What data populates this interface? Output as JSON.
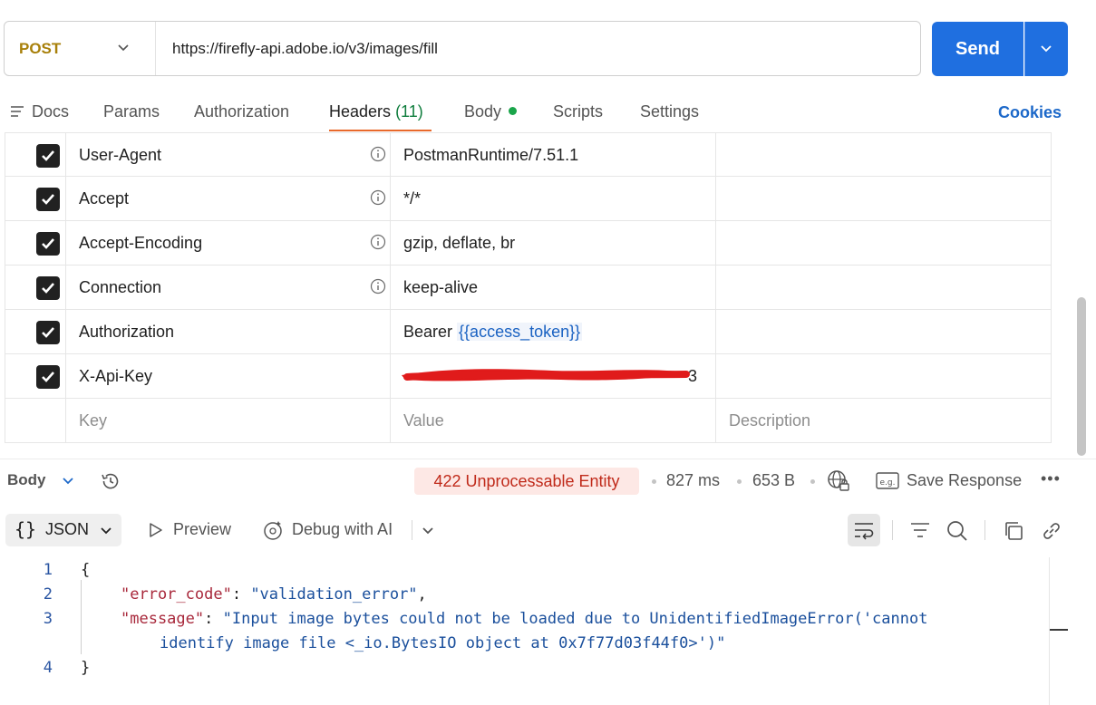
{
  "request": {
    "method": "POST",
    "url": "https://firefly-api.adobe.io/v3/images/fill",
    "send_label": "Send"
  },
  "tabs": [
    {
      "label": "Docs"
    },
    {
      "label": "Params"
    },
    {
      "label": "Authorization"
    },
    {
      "label": "Headers",
      "count": "(11)",
      "active": true
    },
    {
      "label": "Body",
      "has_dot": true
    },
    {
      "label": "Scripts"
    },
    {
      "label": "Settings"
    }
  ],
  "cookies_label": "Cookies",
  "headers": [
    {
      "key": "User-Agent",
      "value": "PostmanRuntime/7.51.1",
      "checked": true,
      "info": true
    },
    {
      "key": "Accept",
      "value": "*/*",
      "checked": true,
      "info": true
    },
    {
      "key": "Accept-Encoding",
      "value": "gzip, deflate, br",
      "checked": true,
      "info": true
    },
    {
      "key": "Connection",
      "value": "keep-alive",
      "checked": true,
      "info": true
    },
    {
      "key": "Authorization",
      "value_prefix": "Bearer ",
      "value_var": "{{access_token}}",
      "checked": true
    },
    {
      "key": "X-Api-Key",
      "value_visible_tail": "3",
      "redacted": true,
      "checked": true
    }
  ],
  "new_row": {
    "key_placeholder": "Key",
    "value_placeholder": "Value",
    "description_placeholder": "Description"
  },
  "response": {
    "body_label": "Body",
    "status": "422 Unprocessable Entity",
    "time": "827 ms",
    "size": "653 B",
    "save_label": "Save Response",
    "more_label": "•••",
    "format": "JSON",
    "format_braces": "{}",
    "preview_label": "Preview",
    "debug_label": "Debug with AI"
  },
  "code": {
    "line_numbers": [
      "1",
      "2",
      "3",
      "4"
    ],
    "open_brace": "{",
    "close_brace": "}",
    "error_code_key": "\"error_code\"",
    "error_code_value": "\"validation_error\"",
    "message_key": "\"message\"",
    "message_value_line1": "\"Input image bytes could not be loaded due to UnidentifiedImageError('cannot",
    "message_value_line2": "identify image file <_io.BytesIO object at 0x7f77d03f44f0>')\""
  },
  "colors": {
    "send_blue": "#1f6fe0",
    "method_post": "#a8800a",
    "tab_active_underline": "#e8692b",
    "status_error": "#c02a1a",
    "status_error_bg": "#fde8e5",
    "redaction": "#e01b1b"
  }
}
